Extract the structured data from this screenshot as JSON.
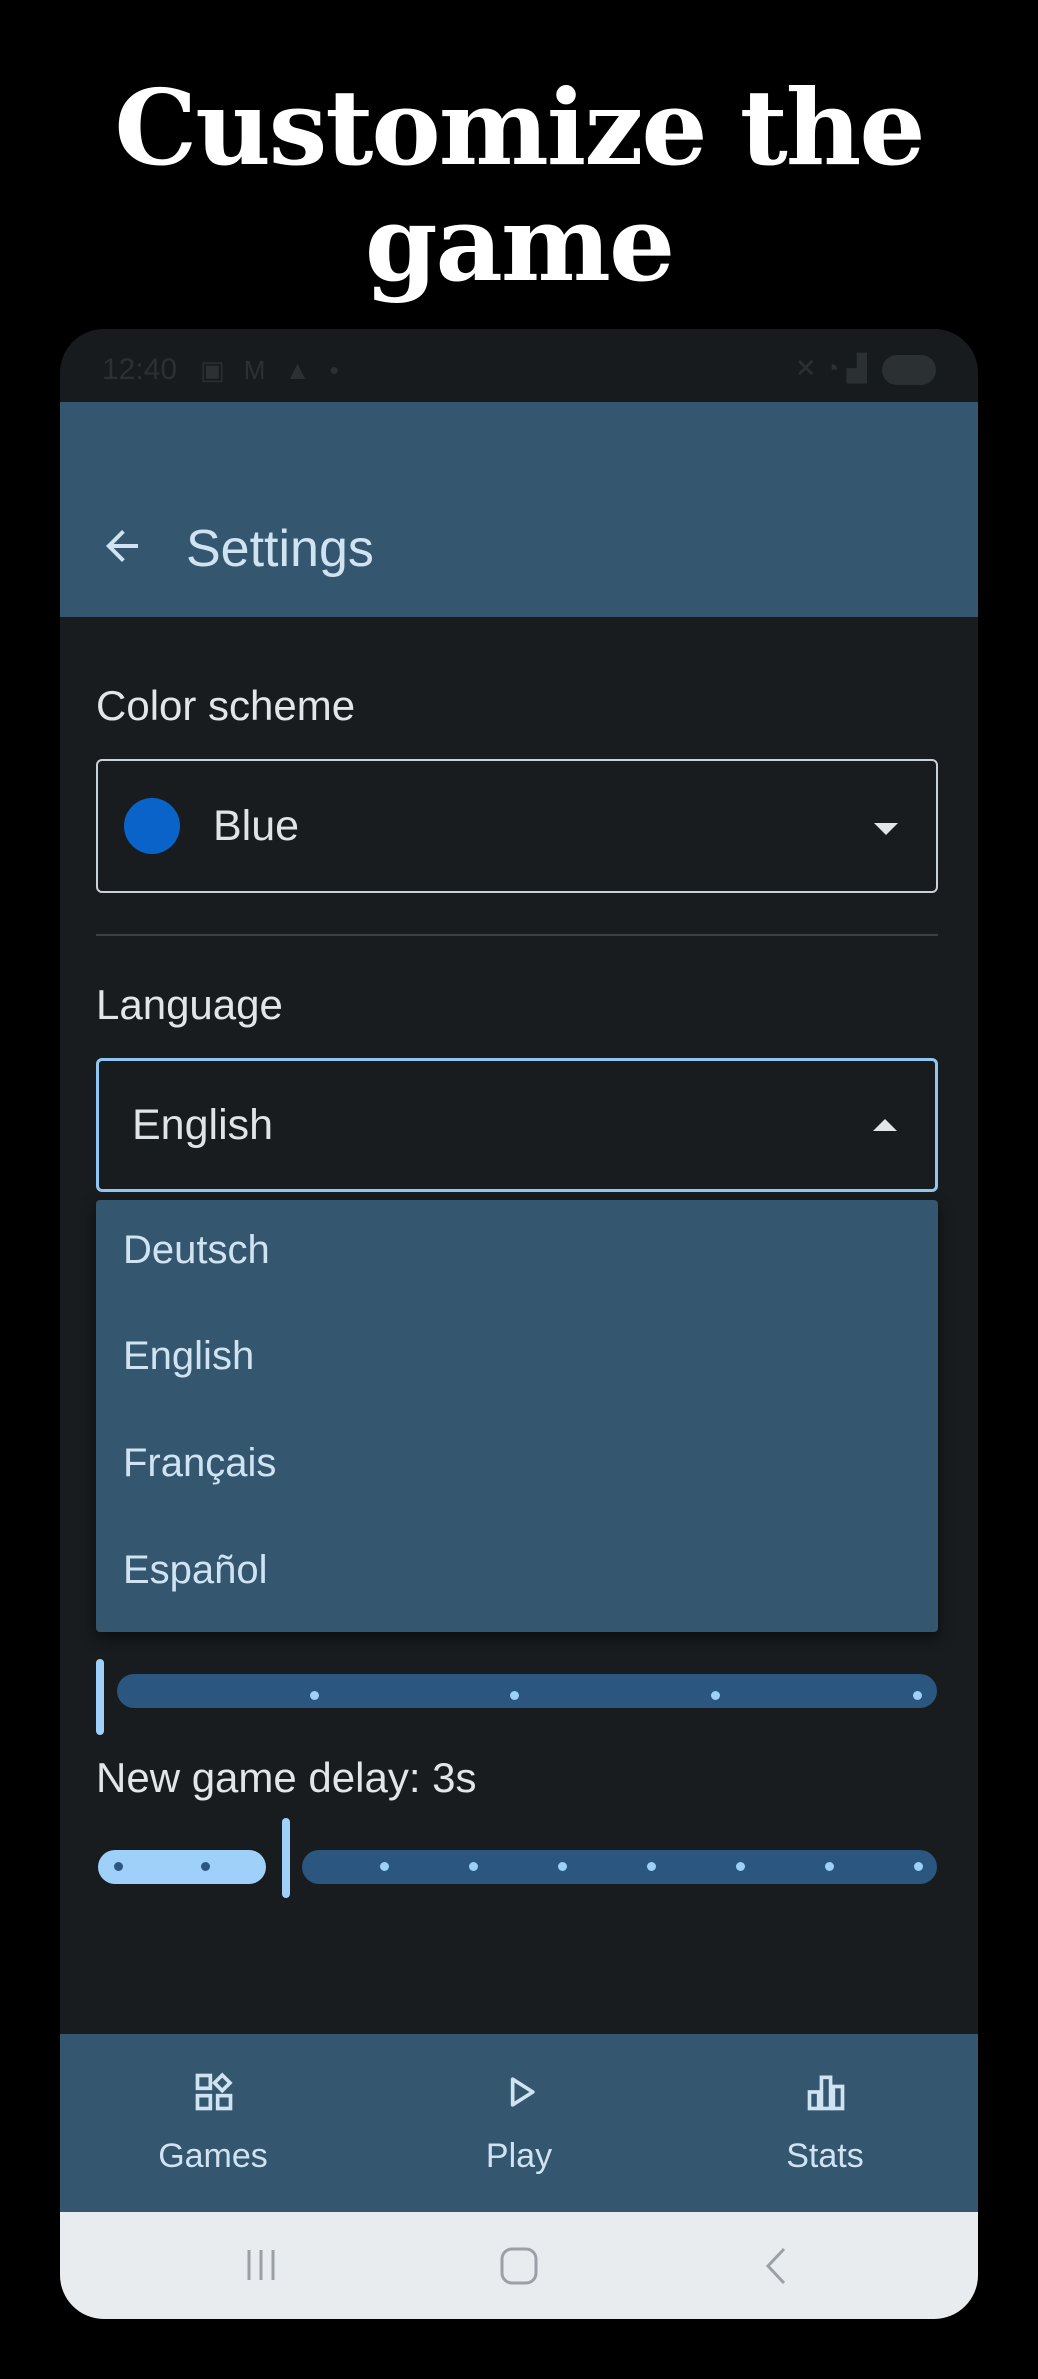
{
  "promo": {
    "line1": "Customize the",
    "line2": "game"
  },
  "status_bar": {
    "time": "12:40"
  },
  "app_bar": {
    "title": "Settings",
    "back_icon": "arrow-left-icon"
  },
  "color_scheme": {
    "label": "Color scheme",
    "value": "Blue",
    "swatch_color": "#0a63c9"
  },
  "language": {
    "label": "Language",
    "value": "English",
    "options": [
      "Deutsch",
      "English",
      "Français",
      "Español"
    ]
  },
  "new_game_delay": {
    "label": "New game delay: 3s",
    "value_fraction": 0.2
  },
  "bottom_nav": {
    "items": [
      {
        "label": "Games",
        "icon": "grid-shapes-icon"
      },
      {
        "label": "Play",
        "icon": "play-icon"
      },
      {
        "label": "Stats",
        "icon": "bar-chart-icon"
      }
    ]
  },
  "colors": {
    "background": "#181c1f",
    "app_bar": "#34566e",
    "accent": "#9fd0fa",
    "track_inactive": "#2a5680"
  }
}
